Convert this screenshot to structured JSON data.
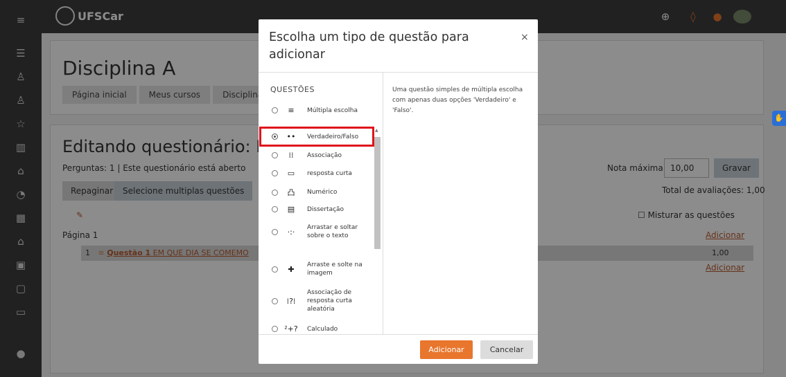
{
  "header": {
    "logo_text": "UFSCar"
  },
  "sidebar": {
    "icons": [
      "menu-icon",
      "list-icon",
      "people-icon",
      "people-alt-icon",
      "star-icon",
      "book-icon",
      "home-icon",
      "gauge-icon",
      "calendar-icon",
      "school-icon",
      "clipboard-icon",
      "clipboard-alt-icon",
      "folder-icon",
      "accessibility-icon"
    ]
  },
  "course": {
    "title": "Disciplina A",
    "breadcrumbs": [
      "Página inicial",
      "Meus cursos",
      "Disciplina_A"
    ]
  },
  "quiz": {
    "title": "Editando questionário: No",
    "info": "Perguntas: 1 | Este questionário está aberto",
    "repaginate": "Repaginar",
    "select_multiple": "Selecione multiplas questões",
    "max_grade_label": "Nota máxima",
    "max_grade_value": "10,00",
    "save": "Gravar",
    "total": "Total de avaliações: 1,00",
    "shuffle": "Misturar as questões",
    "page_label": "Página 1",
    "add": "Adicionar",
    "question_number": "1",
    "question_name": "Questão 1",
    "question_text": "EM QUE DIA SE COMEMO",
    "question_grade": "1,00"
  },
  "modal": {
    "title": "Escolha um tipo de questão para adicionar",
    "close": "×",
    "section": "QUESTÕES",
    "description": "Uma questão simples de múltipla escolha com apenas duas opções 'Verdadeiro' e 'Falso'.",
    "options": [
      {
        "label": "Múltipla escolha",
        "icon": "≡"
      },
      {
        "label": "Verdadeiro/Falso",
        "icon": "••"
      },
      {
        "label": "Associação",
        "icon": "⁞⁞"
      },
      {
        "label": "resposta curta",
        "icon": "▭"
      },
      {
        "label": "Numérico",
        "icon": "凸"
      },
      {
        "label": "Dissertação",
        "icon": "▤"
      },
      {
        "label": "Arrastar e soltar sobre o texto",
        "icon": "·:·"
      },
      {
        "label": "Arraste e solte na imagem",
        "icon": "✚"
      },
      {
        "label": "Associação de resposta curta aleatória",
        "icon": "⁞?⁞"
      },
      {
        "label": "Calculado",
        "icon": "²+?"
      }
    ],
    "selected": "Verdadeiro/Falso",
    "add_button": "Adicionar",
    "cancel_button": "Cancelar"
  }
}
